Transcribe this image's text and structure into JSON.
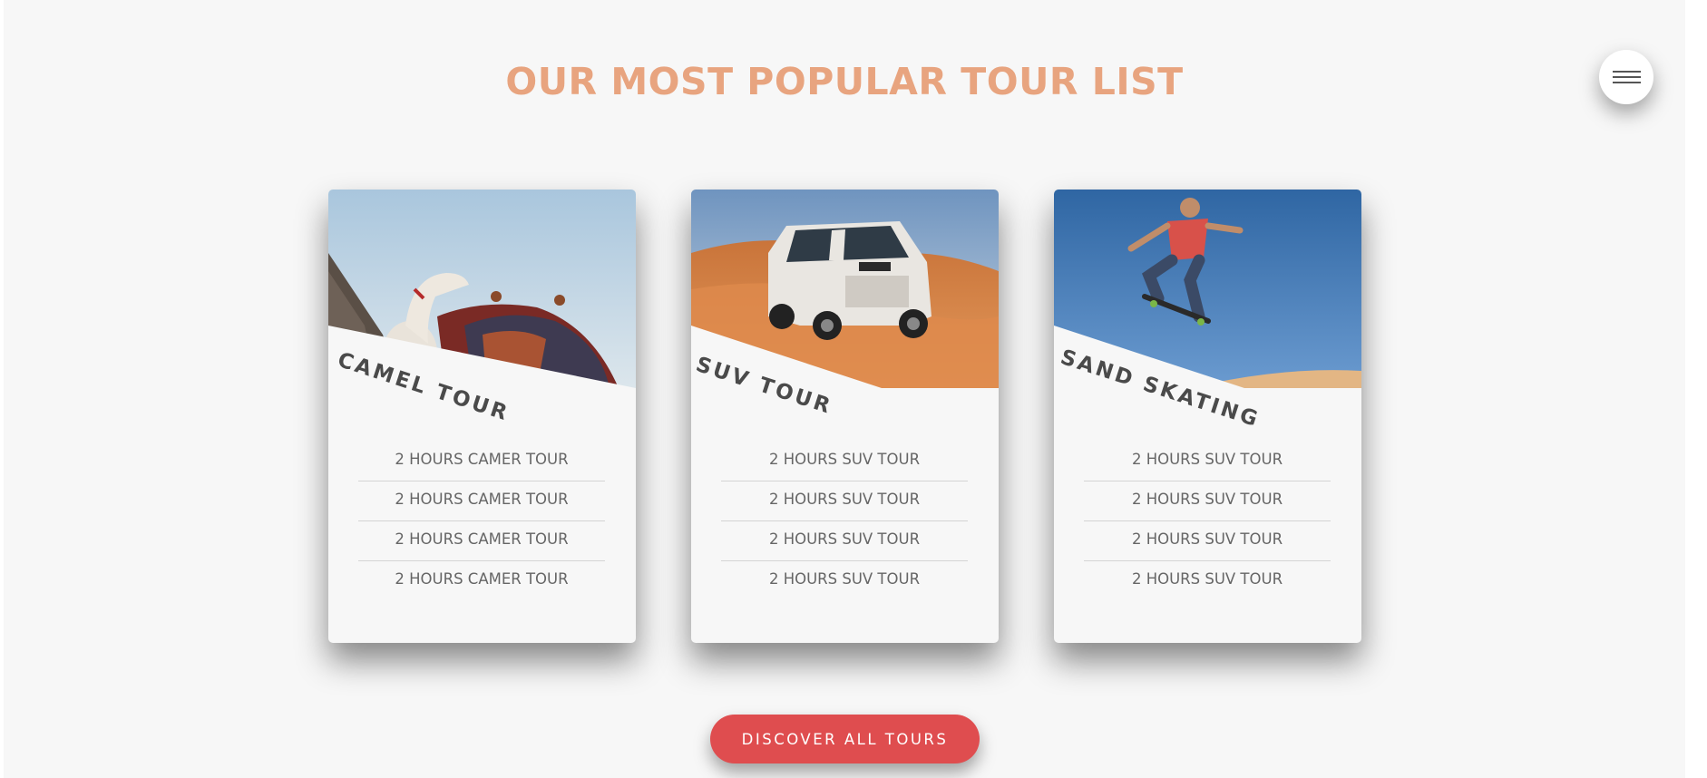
{
  "header": {
    "title": "OUR MOST POPULAR TOUR LIST"
  },
  "menu": {
    "icon": "hamburger-menu-icon"
  },
  "tours": [
    {
      "title": "CAMEL TOUR",
      "image": "camel-photo",
      "items": [
        "2 HOURS CAMER TOUR",
        "2 HOURS CAMER TOUR",
        "2 HOURS CAMER TOUR",
        "2 HOURS CAMER TOUR"
      ]
    },
    {
      "title": "SUV TOUR",
      "image": "suv-in-desert-photo",
      "items": [
        "2 HOURS SUV TOUR",
        "2 HOURS SUV TOUR",
        "2 HOURS SUV TOUR",
        "2 HOURS SUV TOUR"
      ]
    },
    {
      "title": "SAND SKATING",
      "image": "sand-skating-photo",
      "items": [
        "2 HOURS SUV TOUR",
        "2 HOURS SUV TOUR",
        "2 HOURS SUV TOUR",
        "2 HOURS SUV TOUR"
      ]
    }
  ],
  "cta": {
    "label": "DISCOVER ALL TOURS"
  },
  "colors": {
    "title": "#e8a47f",
    "cta": "#df4d4f",
    "background": "#f7f7f7"
  }
}
